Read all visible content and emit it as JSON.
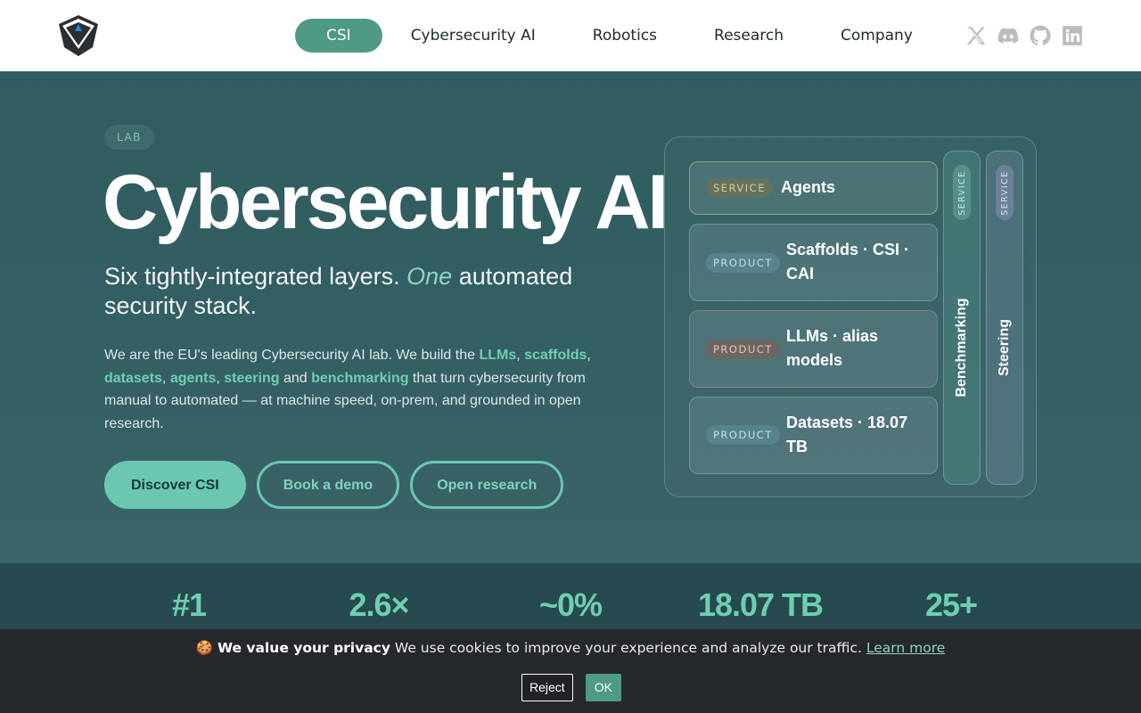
{
  "header": {
    "nav": [
      {
        "label": "CSI",
        "active": true
      },
      {
        "label": "Cybersecurity AI"
      },
      {
        "label": "Robotics"
      },
      {
        "label": "Research"
      },
      {
        "label": "Company"
      }
    ],
    "socials": [
      "x-icon",
      "discord-icon",
      "github-icon",
      "linkedin-icon"
    ]
  },
  "hero": {
    "eyebrow": "LAB",
    "title": "Cybersecurity AI",
    "subtitle_pre": "Six tightly-integrated layers. ",
    "subtitle_em": "One",
    "subtitle_post": " automated security stack.",
    "description": {
      "t1": "We are the EU's leading Cybersecurity AI lab. We build the ",
      "k1": "LLMs",
      "s1": ", ",
      "k2": "scaffolds",
      "s2": ", ",
      "k3": "datasets",
      "s3": ", ",
      "k4": "agents",
      "s4": ", ",
      "k5": "steering",
      "s5": " and ",
      "k6": "benchmarking",
      "t2": " that turn cybersecurity from manual to automated — at machine speed, on-prem, and grounded in open research."
    },
    "buttons": {
      "primary": "Discover CSI",
      "demo": "Book a demo",
      "research": "Open research"
    }
  },
  "stack": {
    "layers": [
      {
        "tag": "SERVICE",
        "title": "Agents"
      },
      {
        "tag": "PRODUCT",
        "title": "Scaffolds · CSI · CAI"
      },
      {
        "tag": "PRODUCT",
        "title": "LLMs · alias models"
      },
      {
        "tag": "PRODUCT",
        "title": "Datasets · 18.07 TB"
      }
    ],
    "verticals": [
      {
        "tag": "SERVICE",
        "label": "Benchmarking"
      },
      {
        "tag": "SERVICE",
        "label": "Steering"
      }
    ]
  },
  "stats": [
    "#1",
    "2.6×",
    "~0%",
    "18.07 TB",
    "25+"
  ],
  "cookie": {
    "emoji": "🍪",
    "bold": "We value your privacy",
    "text": " We use cookies to improve your experience and analyze our traffic. ",
    "link": "Learn more",
    "reject": "Reject",
    "ok": "OK"
  },
  "colors": {
    "accent": "#6cc7b0",
    "nav_active": "#4f9a86",
    "hero_bg": "#2f5d5f",
    "cookie_bg": "#25282c"
  }
}
